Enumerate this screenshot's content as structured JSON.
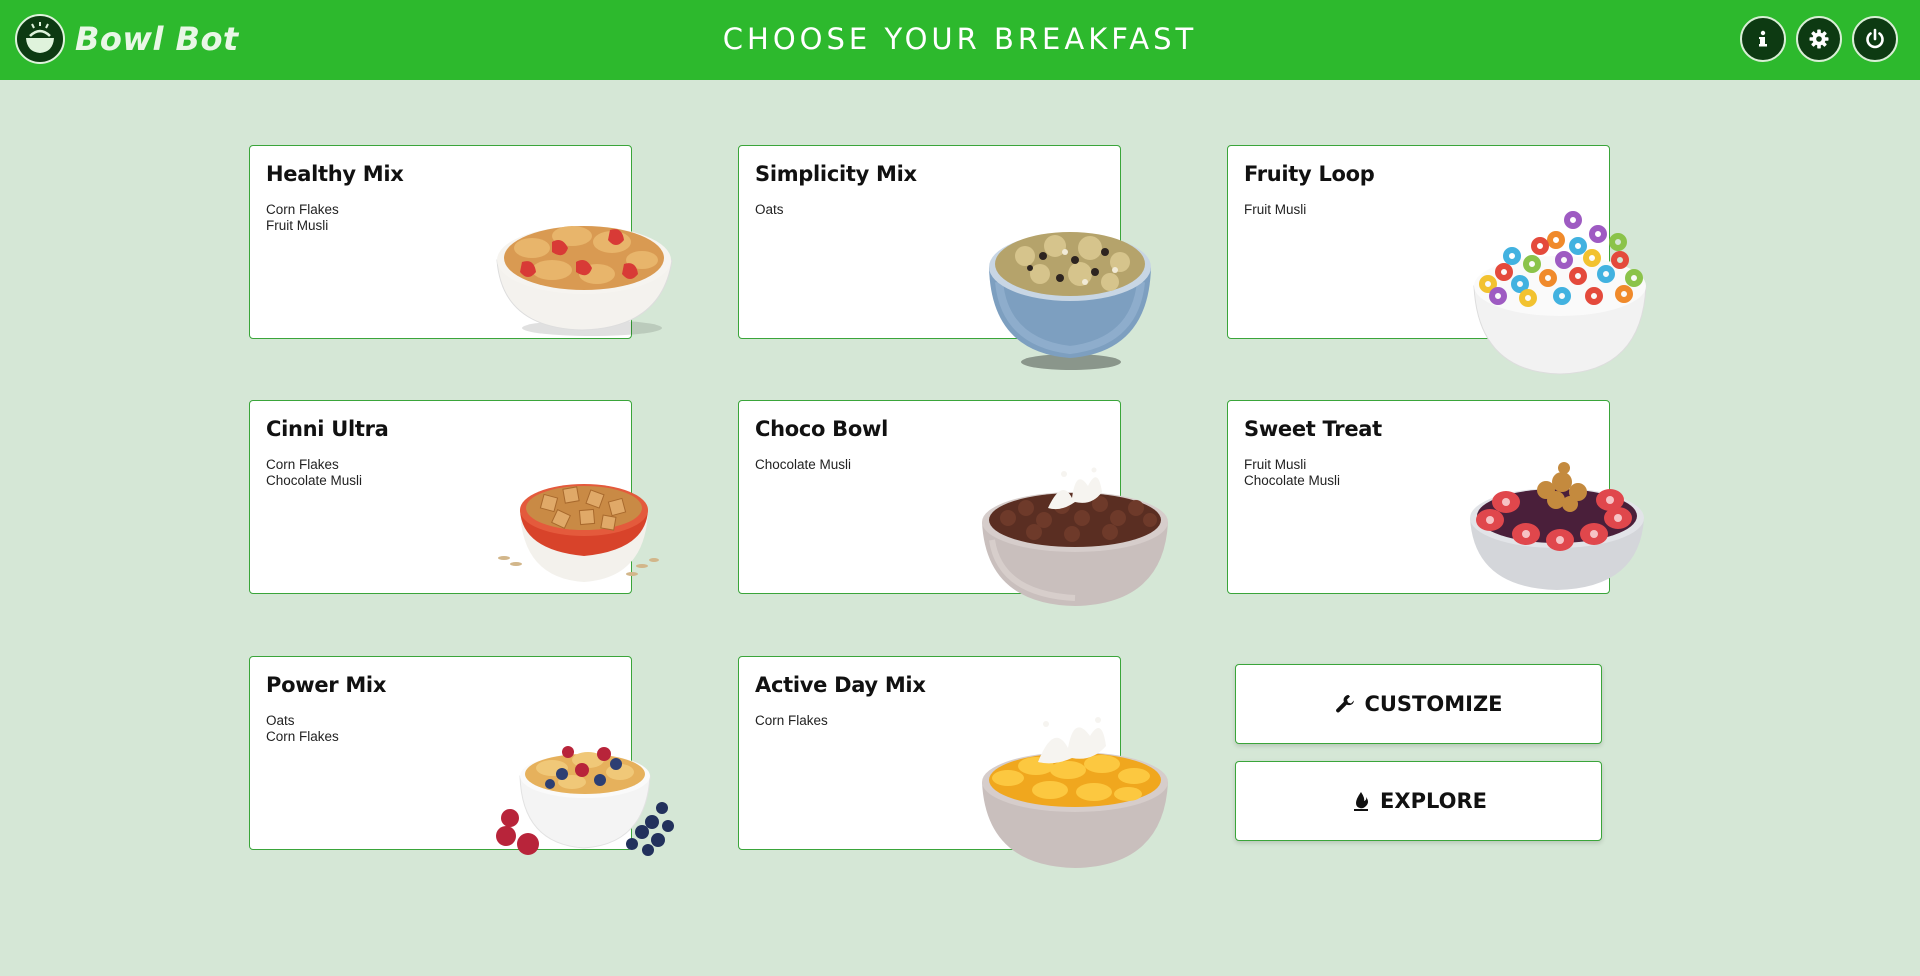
{
  "app": {
    "name": "Bowl Bot",
    "title": "CHOOSE YOUR BREAKFAST"
  },
  "toolbar": {
    "info_icon": "info-icon",
    "settings_icon": "gear-icon",
    "power_icon": "power-icon"
  },
  "colors": {
    "header": "#2db92d",
    "background": "#d5e7d6",
    "card_border": "#3aa53a",
    "dark_button": "#0d3a12"
  },
  "mixes": [
    {
      "name": "Healthy Mix",
      "ingredients": [
        "Corn Flakes",
        "Fruit Musli"
      ],
      "image": "bowl-flakes-strawberry"
    },
    {
      "name": "Simplicity Mix",
      "ingredients": [
        "Oats"
      ],
      "image": "bowl-granola-blue"
    },
    {
      "name": "Fruity Loop",
      "ingredients": [
        "Fruit Musli"
      ],
      "image": "bowl-fruit-loops"
    },
    {
      "name": "Cinni Ultra",
      "ingredients": [
        "Corn Flakes",
        "Chocolate Musli"
      ],
      "image": "bowl-cinnamon-squares"
    },
    {
      "name": "Choco Bowl",
      "ingredients": [
        "Chocolate Musli"
      ],
      "image": "bowl-choco-puffs-milk"
    },
    {
      "name": "Sweet Treat",
      "ingredients": [
        "Fruit Musli",
        "Chocolate Musli"
      ],
      "image": "bowl-strawberry-granola"
    },
    {
      "name": "Power Mix",
      "ingredients": [
        "Oats",
        "Corn Flakes"
      ],
      "image": "bowl-flakes-berries"
    },
    {
      "name": "Active Day Mix",
      "ingredients": [
        "Corn Flakes"
      ],
      "image": "bowl-corn-flakes-milk"
    }
  ],
  "actions": {
    "customize": {
      "label": "CUSTOMIZE",
      "icon": "wrench-icon"
    },
    "explore": {
      "label": "EXPLORE",
      "icon": "flame-icon"
    }
  }
}
